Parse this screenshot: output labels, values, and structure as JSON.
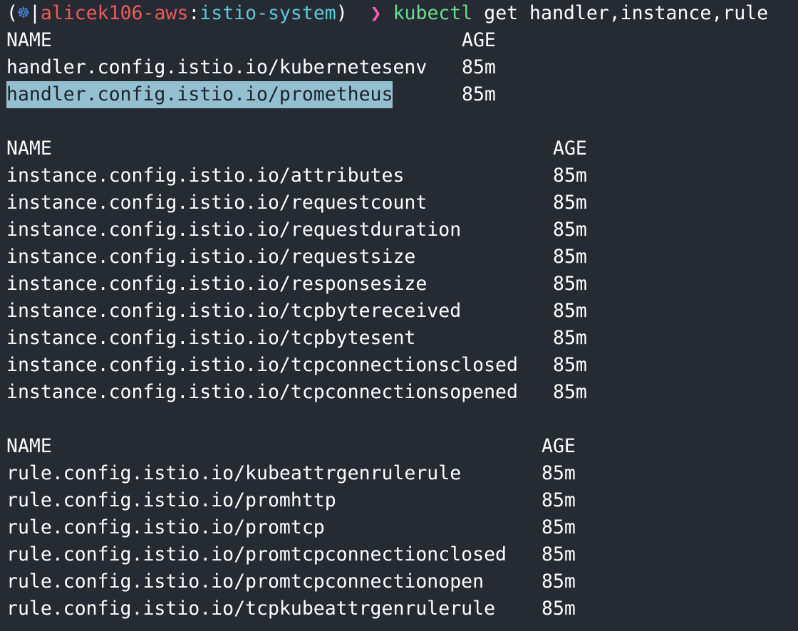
{
  "prompt": {
    "open_paren": "(",
    "k8s_icon": "☸",
    "separator": "|",
    "cluster": "alicek106-aws",
    "colon": ":",
    "namespace": "istio-system",
    "close_paren": ")",
    "arrow": "❯",
    "command": "kubectl",
    "args": "get handler,instance,rule"
  },
  "handlers": {
    "header_name": "NAME",
    "header_age": "AGE",
    "rows": [
      {
        "name": "handler.config.istio.io/kubernetesenv",
        "age": "85m"
      },
      {
        "name": "handler.config.istio.io/prometheus",
        "age": "85m",
        "selected": true
      }
    ]
  },
  "instances": {
    "header_name": "NAME",
    "header_age": "AGE",
    "rows": [
      {
        "name": "instance.config.istio.io/attributes",
        "age": "85m"
      },
      {
        "name": "instance.config.istio.io/requestcount",
        "age": "85m"
      },
      {
        "name": "instance.config.istio.io/requestduration",
        "age": "85m"
      },
      {
        "name": "instance.config.istio.io/requestsize",
        "age": "85m"
      },
      {
        "name": "instance.config.istio.io/responsesize",
        "age": "85m"
      },
      {
        "name": "instance.config.istio.io/tcpbytereceived",
        "age": "85m"
      },
      {
        "name": "instance.config.istio.io/tcpbytesent",
        "age": "85m"
      },
      {
        "name": "instance.config.istio.io/tcpconnectionsclosed",
        "age": "85m"
      },
      {
        "name": "instance.config.istio.io/tcpconnectionsopened",
        "age": "85m"
      }
    ]
  },
  "rules": {
    "header_name": "NAME",
    "header_age": "AGE",
    "rows": [
      {
        "name": "rule.config.istio.io/kubeattrgenrulerule",
        "age": "85m"
      },
      {
        "name": "rule.config.istio.io/promhttp",
        "age": "85m"
      },
      {
        "name": "rule.config.istio.io/promtcp",
        "age": "85m"
      },
      {
        "name": "rule.config.istio.io/promtcpconnectionclosed",
        "age": "85m"
      },
      {
        "name": "rule.config.istio.io/promtcpconnectionopen",
        "age": "85m"
      },
      {
        "name": "rule.config.istio.io/tcpkubeattrgenrulerule",
        "age": "85m"
      }
    ]
  }
}
